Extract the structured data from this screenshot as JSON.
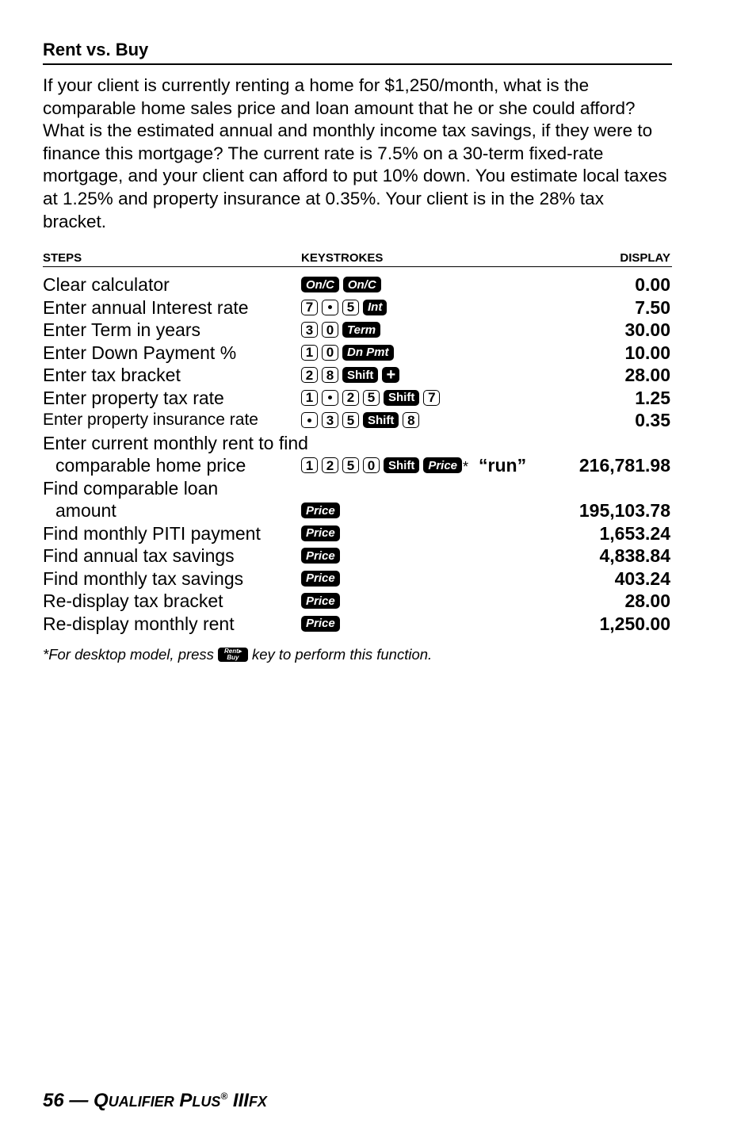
{
  "section_title": "Rent vs. Buy",
  "intro": "If your client is currently renting a home for $1,250/month, what is the comparable home sales price and loan amount that he or she could afford? What is the estimated annual and monthly income tax savings, if they were to finance this mortgage? The current rate is 7.5% on a 30-term fixed-rate mortgage, and your client can afford to put 10% down. You estimate local taxes at 1.25% and property insurance at 0.35%. Your client is in the 28% tax bracket.",
  "headers": {
    "steps": "STEPS",
    "keystrokes": "KEYSTROKES",
    "display": "DISPLAY"
  },
  "rows": [
    {
      "step": "Clear calculator",
      "keys": [
        "On/C",
        "On/C"
      ],
      "display": "0.00"
    },
    {
      "step": "Enter annual Interest rate",
      "keys": [
        "7",
        ".",
        "5",
        "Int"
      ],
      "display": "7.50"
    },
    {
      "step": "Enter Term in years",
      "keys": [
        "3",
        "0",
        "Term"
      ],
      "display": "30.00"
    },
    {
      "step": "Enter Down Payment %",
      "keys": [
        "1",
        "0",
        "Dn Pmt"
      ],
      "display": "10.00"
    },
    {
      "step": "Enter tax bracket",
      "keys": [
        "2",
        "8",
        "Shift",
        "+"
      ],
      "display": "28.00"
    },
    {
      "step": "Enter property tax rate",
      "keys": [
        "1",
        ".",
        "2",
        "5",
        "Shift",
        "7"
      ],
      "display": "1.25"
    },
    {
      "step": "Enter property insurance rate",
      "keys": [
        ".",
        "3",
        "5",
        "Shift",
        "8"
      ],
      "display": "0.35"
    },
    {
      "step": "Enter current monthly rent to find",
      "keys": [],
      "display": ""
    },
    {
      "step": "comparable home price",
      "keys": [
        "1",
        "2",
        "5",
        "0",
        "Shift",
        "Price"
      ],
      "asterisk": "*",
      "note": "“run”",
      "display": "216,781.98"
    },
    {
      "step": "Find comparable loan",
      "keys": [],
      "display": ""
    },
    {
      "step": "amount",
      "keys": [
        "Price"
      ],
      "display": "195,103.78"
    },
    {
      "step": "Find monthly PITI payment",
      "keys": [
        "Price"
      ],
      "display": "1,653.24"
    },
    {
      "step": "Find annual tax savings",
      "keys": [
        "Price"
      ],
      "display": "4,838.84"
    },
    {
      "step": "Find monthly tax savings",
      "keys": [
        "Price"
      ],
      "display": "403.24"
    },
    {
      "step": "Re-display tax bracket",
      "keys": [
        "Price"
      ],
      "display": "28.00"
    },
    {
      "step": "Re-display monthly rent",
      "keys": [
        "Price"
      ],
      "display": "1,250.00"
    }
  ],
  "footnote": {
    "before": "*For desktop model, press",
    "key_top": "Rent▸",
    "key_bottom": "Buy",
    "after": "key to perform this function."
  },
  "footer": {
    "page": "56 —",
    "q": "Q",
    "ualifier": "UALIFIER",
    "p": "P",
    "lus": "LUS",
    "reg": "®",
    "iii": "III",
    "fx": "FX"
  }
}
